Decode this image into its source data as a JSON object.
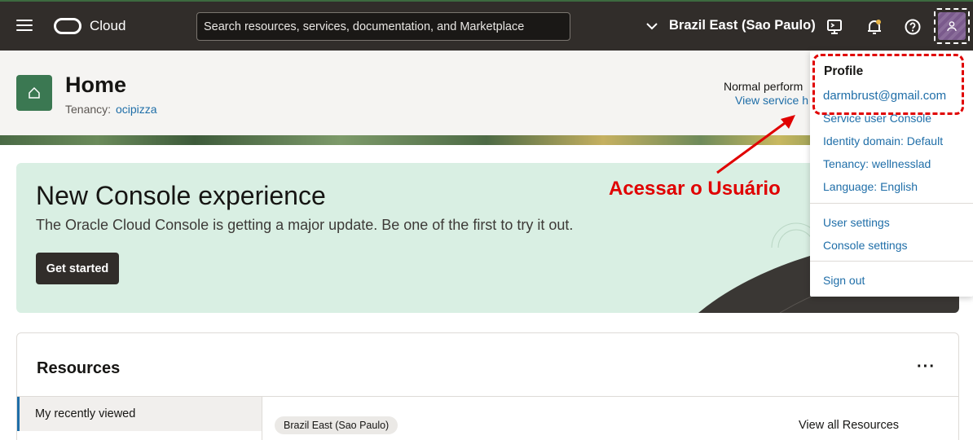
{
  "topnav": {
    "brand": "Cloud",
    "search_placeholder": "Search resources, services, documentation, and Marketplace",
    "region": "Brazil East (Sao Paulo)"
  },
  "header": {
    "title": "Home",
    "tenancy_label": "Tenancy:",
    "tenancy_value": "ocipizza",
    "status": "Normal perform",
    "status_link": "View service h"
  },
  "banner": {
    "title": "New Console experience",
    "subtitle": "The Oracle Cloud Console is getting a major update. Be one of the first to try it out.",
    "button": "Get started"
  },
  "resources": {
    "title": "Resources",
    "more": "···",
    "tab": "My recently viewed",
    "region_pill": "Brazil East (Sao Paulo)",
    "view_all": "View all Resources"
  },
  "profile_menu": {
    "heading": "Profile",
    "email": "darmbrust@gmail.com",
    "items_group1": [
      "Service user Console",
      "Identity domain: Default",
      "Tenancy: wellnesslad",
      "Language: English"
    ],
    "items_group2": [
      "User settings",
      "Console settings"
    ],
    "sign_out": "Sign out"
  },
  "annotation": {
    "text": "Acessar o Usuário",
    "color": "#e00000"
  },
  "icons": [
    "hamburger-icon",
    "oracle-logo-icon",
    "chevron-down-icon",
    "cloud-shell-icon",
    "bell-icon",
    "help-icon",
    "user-icon",
    "home-icon"
  ]
}
